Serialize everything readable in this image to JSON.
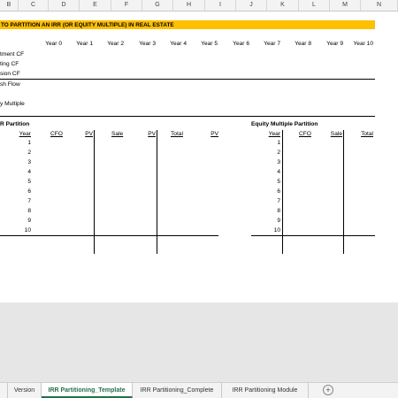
{
  "column_headers": [
    "B",
    "C",
    "D",
    "E",
    "F",
    "G",
    "H",
    "I",
    "J",
    "K",
    "L",
    "M",
    "N"
  ],
  "banner": {
    "title": "TO PARTITION AN IRR (OR EQUITY MULTIPLE) IN REAL ESTATE"
  },
  "year_headers": [
    "Year 0",
    "Year 1",
    "Year 2",
    "Year 3",
    "Year 4",
    "Year 5",
    "Year 6",
    "Year 7",
    "Year 8",
    "Year 9",
    "Year 10"
  ],
  "row_labels": [
    "tment CF",
    "ting CF",
    "sion CF",
    "sh Flow",
    "y Multiple"
  ],
  "irr_partition": {
    "title": "R Partition",
    "headers": [
      "Year",
      "CFO",
      "PV",
      "Sale",
      "PV",
      "Total",
      "PV"
    ],
    "years": [
      "1",
      "2",
      "3",
      "4",
      "5",
      "6",
      "7",
      "8",
      "9",
      "10"
    ]
  },
  "em_partition": {
    "title": "Equity Multiple Partition",
    "headers": [
      "Year",
      "CFO",
      "Sale",
      "Total"
    ],
    "years": [
      "1",
      "2",
      "3",
      "4",
      "5",
      "6",
      "7",
      "8",
      "9",
      "10"
    ]
  },
  "sheet_tabs": [
    "Version",
    "IRR Partitioning_Template",
    "IRR Partitioning_Complete",
    "IRR Partitioning Module"
  ],
  "active_tab": "IRR Partitioning_Template",
  "colors": {
    "banner": "#ffc000",
    "active_tab": "#217346"
  }
}
